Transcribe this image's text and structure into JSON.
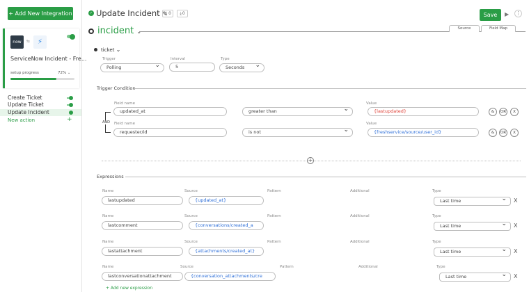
{
  "sidebar": {
    "add_button": "+ Add New Integration",
    "card": {
      "logo_left": "now",
      "title": "ServiceNow Incident - Fre...",
      "setup_label": "setup progress",
      "setup_pct": "72%",
      "progress": 0.72
    },
    "actions": [
      {
        "label": "Create Ticket"
      },
      {
        "label": "Update Ticket"
      },
      {
        "label": "Update Incident"
      }
    ],
    "new_action": "New action"
  },
  "header": {
    "title": "Update Incident",
    "badge1": "0",
    "badge2": "0",
    "save": "Save"
  },
  "object": {
    "name": "incident",
    "tabs": [
      "Source",
      "Field Map"
    ]
  },
  "ticket": {
    "label": "ticket",
    "trigger_label": "Trigger",
    "trigger_value": "Polling",
    "interval_label": "Interval",
    "interval_value": "5",
    "type_label": "Type",
    "type_value": "Seconds"
  },
  "trigger_condition": {
    "title": "Trigger Condition",
    "field_label": "Field name",
    "value_label": "Value",
    "and_label": "AND",
    "btn_and": "&",
    "btn_or": "OR",
    "btn_x": "X",
    "rows": [
      {
        "field": "updated_at",
        "op": "greater than",
        "value": "{lastupdated}"
      },
      {
        "field": "requester/id",
        "op": "is not",
        "value": "{freshservice/source/user_id}"
      }
    ]
  },
  "expressions": {
    "title": "Expressions",
    "name_label": "Name",
    "source_label": "Source",
    "pattern_label": "Pattern",
    "additional_label": "Additional",
    "type_label": "Type",
    "remove": "X",
    "rows": [
      {
        "name": "lastupdated",
        "source": "{updated_at}",
        "type": "Last time"
      },
      {
        "name": "lastcomment",
        "source": "{conversations/created_a",
        "type": "Last time"
      },
      {
        "name": "lastattachment",
        "source": "{attachments/created_at}",
        "type": "Last time"
      },
      {
        "name": "lastconversationattachment",
        "source": "{conversation_attachments/cre",
        "type": "Last time"
      }
    ],
    "add_new": "+ Add new expression"
  },
  "colors": {
    "accent": "#2a9d46",
    "link": "#2e6fd8",
    "error": "#e0453c"
  }
}
